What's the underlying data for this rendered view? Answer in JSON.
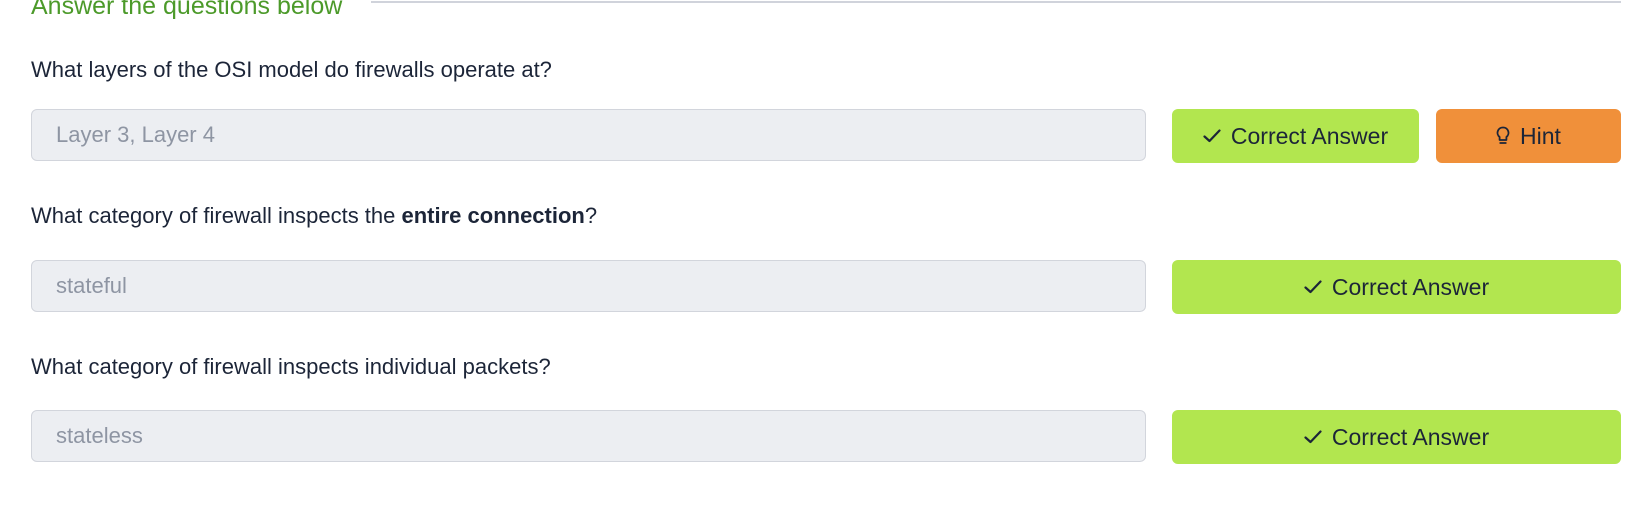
{
  "section": {
    "title": "Answer the questions below"
  },
  "questions": [
    {
      "text": "What layers of the OSI model do firewalls operate at?",
      "answer": "Layer 3, Layer 4",
      "status_label": "Correct Answer",
      "hint_label": "Hint"
    },
    {
      "text_before": "What category of firewall inspects the ",
      "text_bold": "entire connection",
      "text_after": "?",
      "answer": "stateful",
      "status_label": "Correct Answer"
    },
    {
      "text": "What category of firewall inspects individual packets?",
      "answer": "stateless",
      "status_label": "Correct Answer"
    }
  ],
  "icons": {
    "correct": "check-icon",
    "hint": "lightbulb-icon"
  },
  "colors": {
    "section_title": "#4c9a2a",
    "correct_button": "#b2e64f",
    "hint_button": "#f0903a",
    "field_background": "#eceef2"
  }
}
